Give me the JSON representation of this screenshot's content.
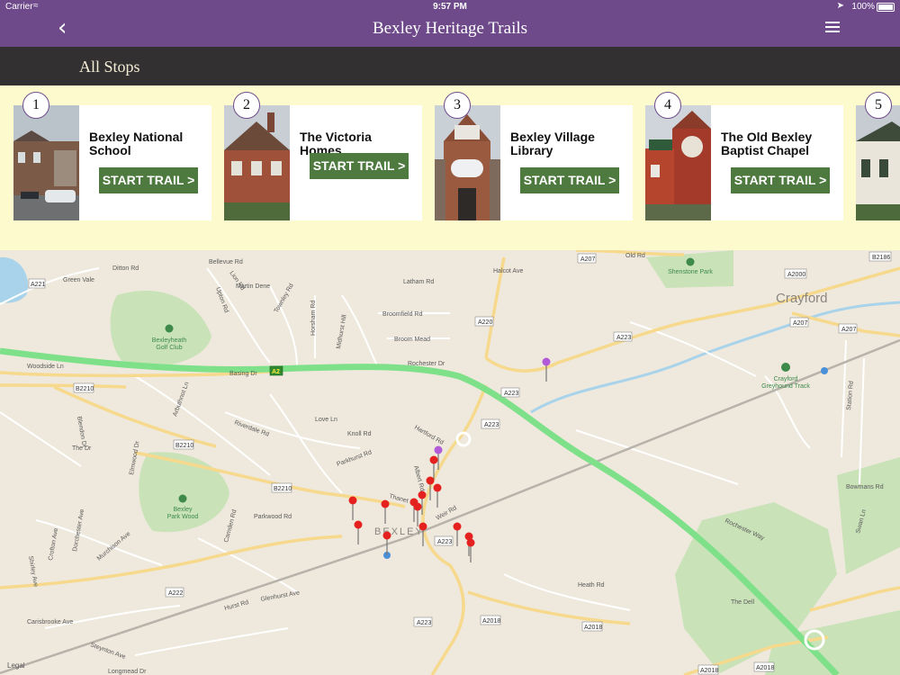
{
  "status": {
    "carrier": "Carrier",
    "time": "9:57 PM",
    "battery": "100%"
  },
  "nav": {
    "title": "Bexley Heritage Trails"
  },
  "subheader": {
    "label": "All Stops"
  },
  "stops": [
    {
      "number": "1",
      "name": "Bexley National School",
      "button": "START TRAIL >"
    },
    {
      "number": "2",
      "name": "The Victoria Homes",
      "button": "START TRAIL >"
    },
    {
      "number": "3",
      "name": "Bexley Village Library",
      "button": "START TRAIL >"
    },
    {
      "number": "4",
      "name": "The Old Bexley Baptist Chapel",
      "button": "START TRAIL >"
    },
    {
      "number": "5",
      "name": "",
      "button": ""
    }
  ],
  "map": {
    "legal": "Legal",
    "town_labels": [
      "Crayford",
      "BEXLEY"
    ],
    "road_labels": [
      "A221",
      "Green Vale",
      "Ditton Rd",
      "Bellevue Rd",
      "Lion Rd",
      "Martin Dene",
      "Upton Rd",
      "Townley Rd",
      "Latham Rd",
      "Halcot Ave",
      "A207",
      "Old Rd",
      "A2000",
      "B2186",
      "Broomfield Rd",
      "Broom Mead",
      "A220",
      "A223",
      "Rochester Dr",
      "Basing Dr",
      "A2",
      "B2210",
      "Arbuthnot Ln",
      "Riverdale Rd",
      "Love Ln",
      "Knoll Rd",
      "Parkhurst Rd",
      "Thanet Rd",
      "Albert Rd",
      "Weir Rd",
      "A223",
      "Heath Rd",
      "A2018",
      "A222",
      "Hurst Rd",
      "Parkwood Rd",
      "Camden Rd",
      "Glenhurst Ave",
      "Murchison Ave",
      "Longmead Dr",
      "The Dr",
      "Elmwood Dr",
      "Blendon Dr",
      "Woodside Ln",
      "Station Rd",
      "Bowmans Rd",
      "Rochester Way",
      "Swan Ln",
      "The Dell",
      "A207",
      "Carisbrooke Ave",
      "Steynton Ave",
      "Crofton Ave",
      "Dorchester Ave",
      "Shirley Ave",
      "Hartford Rd"
    ],
    "poi_labels": [
      "Bexleyheath Golf Club",
      "Shenstone Park",
      "Bexley Park Wood",
      "Crayford Greyhound Track"
    ]
  },
  "colors": {
    "nav": "#6e4a8b",
    "subbar": "#323030",
    "strip": "#fdfacd",
    "button": "#4e7a3f",
    "motorway": "#7fe08a"
  }
}
